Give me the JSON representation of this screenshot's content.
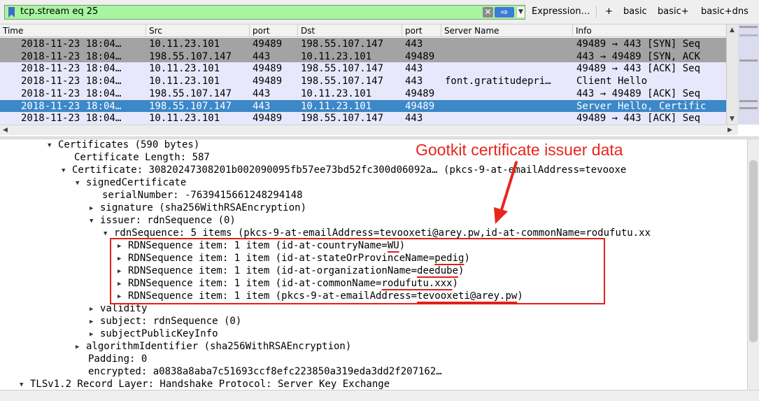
{
  "toolbar": {
    "filter_value": "tcp.stream eq 25",
    "clear_glyph": "✕",
    "apply_glyph": "⇨",
    "dropdown_glyph": "▼",
    "expression_label": "Expression…",
    "add_glyph": "+",
    "buttons": [
      "basic",
      "basic+",
      "basic+dns"
    ]
  },
  "packet_list": {
    "columns": [
      "Time",
      "Src",
      "port",
      "Dst",
      "port",
      "Server Name",
      "Info"
    ],
    "rows": [
      {
        "time": "2018-11-23 18:04…",
        "src": "10.11.23.101",
        "sport": "49489",
        "dst": "198.55.107.147",
        "dport": "443",
        "server": "",
        "info": "49489 → 443 [SYN] Seq",
        "style": "dark"
      },
      {
        "time": "2018-11-23 18:04…",
        "src": "198.55.107.147",
        "sport": "443",
        "dst": "10.11.23.101",
        "dport": "49489",
        "server": "",
        "info": "443 → 49489 [SYN, ACK",
        "style": "dark"
      },
      {
        "time": "2018-11-23 18:04…",
        "src": "10.11.23.101",
        "sport": "49489",
        "dst": "198.55.107.147",
        "dport": "443",
        "server": "",
        "info": "49489 → 443 [ACK] Seq",
        "style": "light"
      },
      {
        "time": "2018-11-23 18:04…",
        "src": "10.11.23.101",
        "sport": "49489",
        "dst": "198.55.107.147",
        "dport": "443",
        "server": "font.gratitudepri…",
        "info": "Client Hello",
        "style": "light"
      },
      {
        "time": "2018-11-23 18:04…",
        "src": "198.55.107.147",
        "sport": "443",
        "dst": "10.11.23.101",
        "dport": "49489",
        "server": "",
        "info": "443 → 49489 [ACK] Seq",
        "style": "light"
      },
      {
        "time": "2018-11-23 18:04…",
        "src": "198.55.107.147",
        "sport": "443",
        "dst": "10.11.23.101",
        "dport": "49489",
        "server": "",
        "info": "Server Hello, Certific",
        "style": "selected"
      },
      {
        "time": "2018-11-23 18:04…",
        "src": "10.11.23.101",
        "sport": "49489",
        "dst": "198.55.107.147",
        "dport": "443",
        "server": "",
        "info": "49489 → 443 [ACK] Seq",
        "style": "light"
      }
    ]
  },
  "details": {
    "lines": [
      {
        "indent": 68,
        "tri": "▼",
        "text": "Certificates (590 bytes)"
      },
      {
        "indent": 106,
        "tri": "",
        "text": "Certificate Length: 587"
      },
      {
        "indent": 88,
        "tri": "▼",
        "text": "Certificate: 30820247308201b002090095fb57ee73bd52fc300d06092a… (pkcs-9-at-emailAddress=tevooxe"
      },
      {
        "indent": 108,
        "tri": "▼",
        "text": "signedCertificate"
      },
      {
        "indent": 146,
        "tri": "",
        "text": "serialNumber: -7639415661248294148"
      },
      {
        "indent": 128,
        "tri": "▶",
        "text": "signature (sha256WithRSAEncryption)"
      },
      {
        "indent": 128,
        "tri": "▼",
        "text": "issuer: rdnSequence (0)"
      },
      {
        "indent": 148,
        "tri": "▼",
        "text": "rdnSequence: 5 items (pkcs-9-at-emailAddress=tevooxeti@arey.pw,id-at-commonName=rodufutu.xx"
      },
      {
        "indent": 168,
        "tri": "▶",
        "pre": "RDNSequence item: 1 item (id-at-countryName=",
        "ul": "WU",
        "post": ")"
      },
      {
        "indent": 168,
        "tri": "▶",
        "pre": "RDNSequence item: 1 item (id-at-stateOrProvinceName=",
        "ul": "pedig",
        "post": ")"
      },
      {
        "indent": 168,
        "tri": "▶",
        "pre": "RDNSequence item: 1 item (id-at-organizationName=",
        "ul": "deedube",
        "post": ")"
      },
      {
        "indent": 168,
        "tri": "▶",
        "pre": "RDNSequence item: 1 item (id-at-commonName=",
        "ul": "rodufutu.xxx",
        "post": ")"
      },
      {
        "indent": 168,
        "tri": "▶",
        "pre": "RDNSequence item: 1 item (pkcs-9-at-emailAddress=",
        "ul": "tevooxeti@arey.pw",
        "post": ")"
      },
      {
        "indent": 128,
        "tri": "▶",
        "text": "validity"
      },
      {
        "indent": 128,
        "tri": "▶",
        "text": "subject: rdnSequence (0)"
      },
      {
        "indent": 128,
        "tri": "▶",
        "text": "subjectPublicKeyInfo"
      },
      {
        "indent": 108,
        "tri": "▶",
        "text": "algorithmIdentifier (sha256WithRSAEncryption)"
      },
      {
        "indent": 126,
        "tri": "",
        "text": "Padding: 0"
      },
      {
        "indent": 126,
        "tri": "",
        "text": "encrypted: a0838a8aba7c51693ccf8efc223850a319eda3dd2f207162…"
      },
      {
        "indent": 28,
        "tri": "▼",
        "text": "TLSv1.2 Record Layer: Handshake Protocol: Server Key Exchange"
      }
    ]
  },
  "annotation": {
    "label": "Gootkit certificate issuer data",
    "color": "#e8261e"
  },
  "colors": {
    "row_dark": "#a3a3a3",
    "row_light": "#e8e8fc",
    "row_selected": "#3c88c8",
    "filter_bg": "#a8f5a0"
  }
}
